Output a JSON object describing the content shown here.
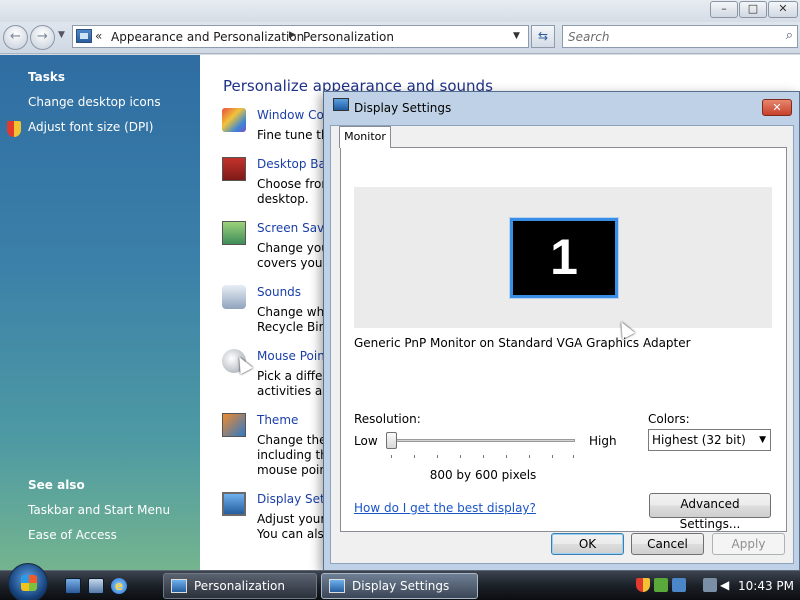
{
  "window": {
    "min": "–",
    "max": "□",
    "close": "✕"
  },
  "nav": {
    "back": "←",
    "forward": "→",
    "history": "▼",
    "address_prefix": "«",
    "breadcrumb": [
      "Appearance and Personalization",
      "Personalization"
    ],
    "crumb_separator": "▶",
    "dropdown": "▼",
    "refresh": "⇆",
    "search_placeholder": "Search",
    "search_icon": "⌕"
  },
  "sidebar": {
    "tasks_heading": "Tasks",
    "tasks": [
      "Change desktop icons",
      "Adjust font size (DPI)"
    ],
    "see_also_heading": "See also",
    "see_also": [
      "Taskbar and Start Menu",
      "Ease of Access"
    ]
  },
  "content": {
    "heading": "Personalize appearance and sounds",
    "categories": [
      {
        "title": "Window Col",
        "desc": [
          "Fine tune the"
        ]
      },
      {
        "title": "Desktop Bac",
        "desc": [
          "Choose from",
          "desktop."
        ]
      },
      {
        "title": "Screen Saver",
        "desc": [
          "Change your",
          "covers your s"
        ]
      },
      {
        "title": "Sounds",
        "desc": [
          "Change which",
          "Recycle Bin."
        ]
      },
      {
        "title": "Mouse Point",
        "desc": [
          "Pick a differe",
          "activities as c"
        ]
      },
      {
        "title": "Theme",
        "desc": [
          "Change the t",
          "including the",
          "mouse point"
        ]
      },
      {
        "title": "Display Setti",
        "desc": [
          "Adjust your r",
          "You can also"
        ]
      }
    ]
  },
  "dialog": {
    "title": "Display Settings",
    "close": "✕",
    "tab": "Monitor",
    "monitor_number": "1",
    "monitor_name": "Generic PnP Monitor on Standard VGA Graphics Adapter",
    "resolution_label": "Resolution:",
    "low": "Low",
    "high": "High",
    "resolution_value": "800 by 600 pixels",
    "resolution_level": 0,
    "colors_label": "Colors:",
    "colors_value": "Highest (32 bit)",
    "colors_arrow": "▼",
    "help_link": "How do I get the best display?",
    "advanced": "Advanced Settings...",
    "ok": "OK",
    "cancel": "Cancel",
    "apply": "Apply"
  },
  "taskbar": {
    "ie_glyph": "e",
    "tasks": [
      "Personalization",
      "Display Settings"
    ],
    "volume": "◀",
    "clock": "10:43 PM"
  },
  "colors": {
    "link": "#1a3fa8",
    "heading": "#1e3287",
    "monitor_highlight": "#3a8ee6"
  }
}
